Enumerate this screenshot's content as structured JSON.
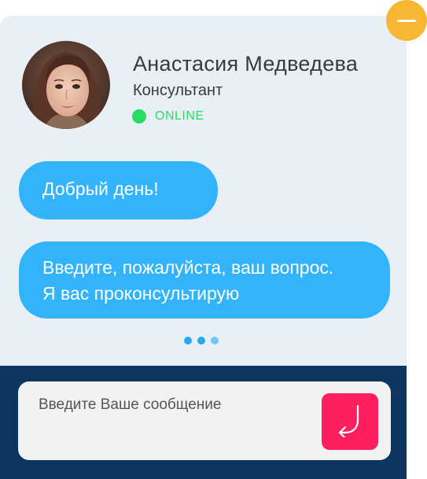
{
  "agent": {
    "name": "Анастасия Медведева",
    "role": "Консультант",
    "status": "ONLINE"
  },
  "messages": [
    {
      "lines": [
        "Добрый день!"
      ]
    },
    {
      "lines": [
        "Введите, пожалуйста, ваш вопрос.",
        "Я вас проконсультирую"
      ]
    }
  ],
  "typing_indicator": {
    "dot_colors": [
      "#2aa8f0",
      "#2aa8f0",
      "#6ccaf7"
    ]
  },
  "composer": {
    "placeholder": "Введите Ваше сообщение"
  },
  "icons": {
    "minimize": "minimize-icon",
    "send": "return-arrow-icon",
    "status": "online-dot-icon"
  },
  "colors": {
    "panel_background": "#e9f0f5",
    "bubble": "#33b4fa",
    "footer": "#0c3560",
    "send_button": "#ff1f5e",
    "minimize_button": "#f7b733",
    "online": "#2bdc62"
  }
}
